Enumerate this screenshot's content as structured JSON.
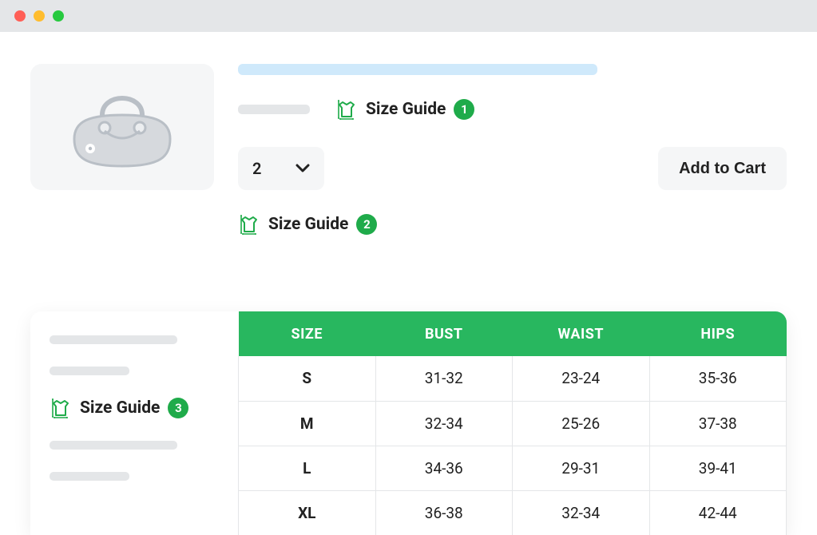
{
  "sizeGuide": {
    "label": "Size Guide",
    "badges": {
      "pos1": "1",
      "pos2": "2",
      "pos3": "3"
    }
  },
  "qty": {
    "value": "2"
  },
  "addToCart": {
    "label": "Add to Cart"
  },
  "table": {
    "headers": {
      "size": "SIZE",
      "bust": "BUST",
      "waist": "WAIST",
      "hips": "HIPS"
    },
    "rows": [
      {
        "size": "S",
        "bust": "31-32",
        "waist": "23-24",
        "hips": "35-36"
      },
      {
        "size": "M",
        "bust": "32-34",
        "waist": "25-26",
        "hips": "37-38"
      },
      {
        "size": "L",
        "bust": "34-36",
        "waist": "29-31",
        "hips": "39-41"
      },
      {
        "size": "XL",
        "bust": "36-38",
        "waist": "32-34",
        "hips": "42-44"
      }
    ]
  },
  "colors": {
    "accent": "#28b75f",
    "badge": "#1fab4a"
  }
}
